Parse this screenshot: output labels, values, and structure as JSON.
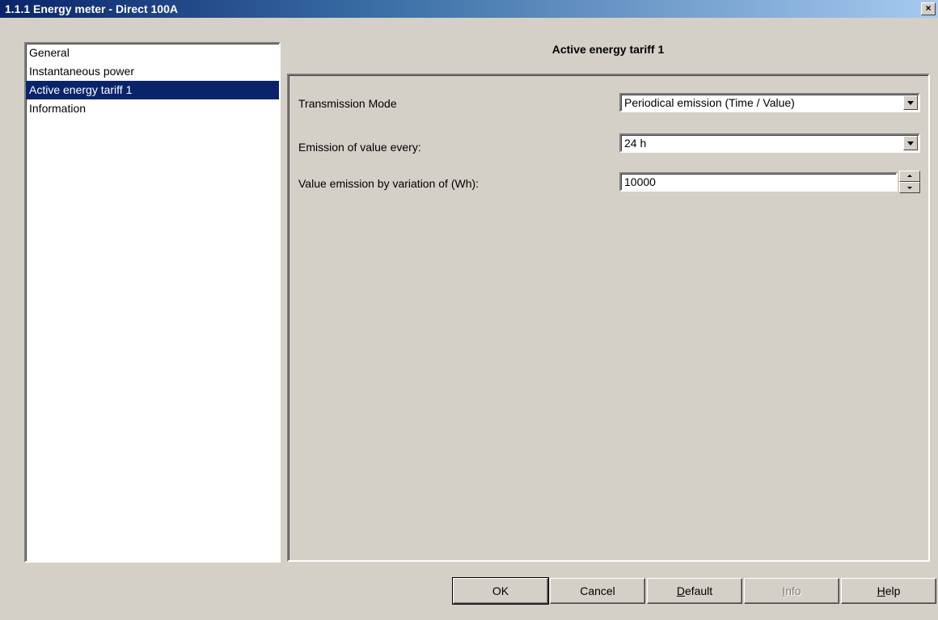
{
  "window": {
    "title": "1.1.1 Energy meter - Direct 100A",
    "close_label": "×"
  },
  "sidebar": {
    "items": [
      {
        "label": "General",
        "selected": false
      },
      {
        "label": "Instantaneous power",
        "selected": false
      },
      {
        "label": "Active energy tariff 1",
        "selected": true
      },
      {
        "label": "Information",
        "selected": false
      }
    ]
  },
  "panel": {
    "title": "Active energy tariff 1",
    "params": [
      {
        "label": "Transmission Mode",
        "value": "Periodical emission (Time / Value)",
        "control": "dropdown"
      },
      {
        "label": "Emission of value every:",
        "value": "24 h",
        "control": "dropdown"
      },
      {
        "label": "Value emission by variation of (Wh):",
        "value": "10000",
        "control": "spinner"
      }
    ]
  },
  "buttons": {
    "ok": "OK",
    "cancel": "Cancel",
    "default_rest": "efault",
    "default_mnemonic": "D",
    "info_rest": "nfo",
    "info_mnemonic": "I",
    "help_rest": "elp",
    "help_mnemonic": "H"
  },
  "colors": {
    "face": "#d4d0c8",
    "selection": "#0a246a",
    "title_gradient_start": "#0a246a",
    "title_gradient_end": "#a6caf0"
  }
}
